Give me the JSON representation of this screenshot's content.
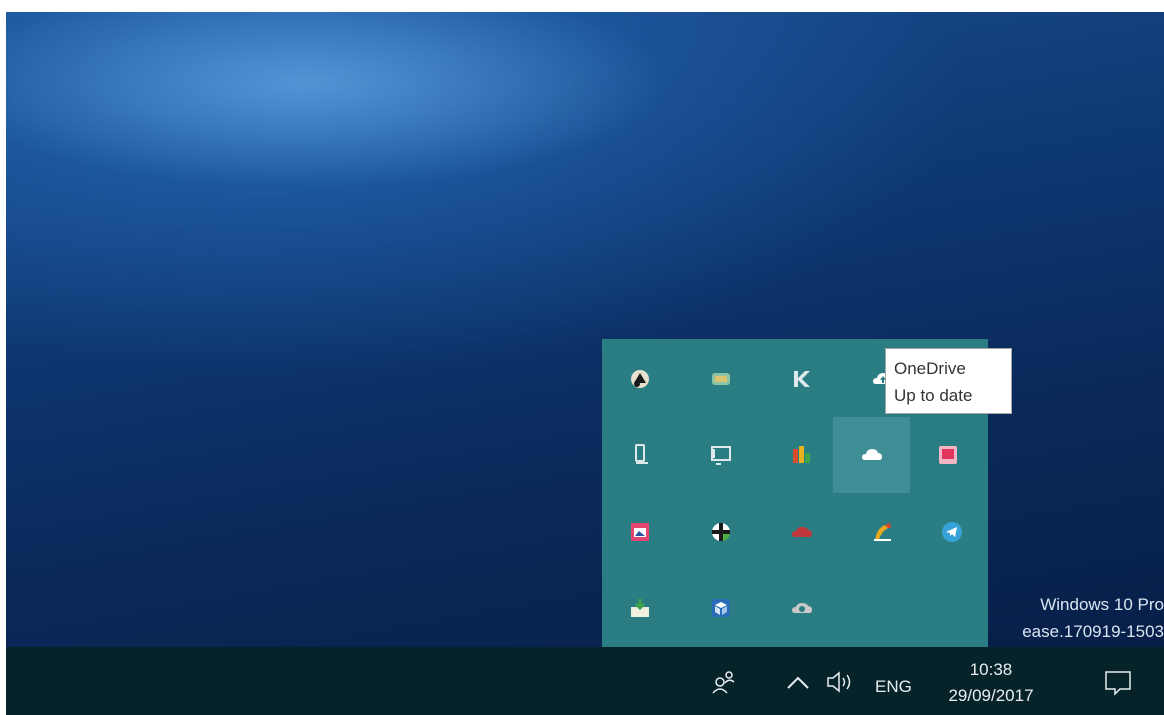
{
  "desktop": {
    "watermark_line1": "Windows 10 Pro",
    "watermark_line2": "ease.170919-1503"
  },
  "tray_overflow": {
    "icons": [
      "kde-connect-icon",
      "network-status-icon",
      "k-app-icon",
      "onedrive-upload-icon",
      "usb-drive-icon",
      "display-settings-icon",
      "color-bars-icon",
      "onedrive-icon",
      "pink-app-icon",
      "image-app-icon",
      "shield-cross-icon",
      "red-cloud-icon",
      "color-pencil-icon",
      "telegram-icon",
      "download-tray-icon",
      "cube-app-icon",
      "gray-cloud-icon"
    ],
    "tooltip": {
      "title": "OneDrive",
      "status": "Up to date"
    }
  },
  "taskbar": {
    "people_icon": "people-icon",
    "show_hidden_icon": "chevron-up-icon",
    "volume_icon": "speaker-icon",
    "language": "ENG",
    "time": "10:38",
    "date": "29/09/2017",
    "notification_icon": "action-center-icon"
  },
  "colors": {
    "flyout_bg": "#2a7d83",
    "taskbar_bg": "#06232a",
    "desktop_blue": "#0f3a75"
  }
}
